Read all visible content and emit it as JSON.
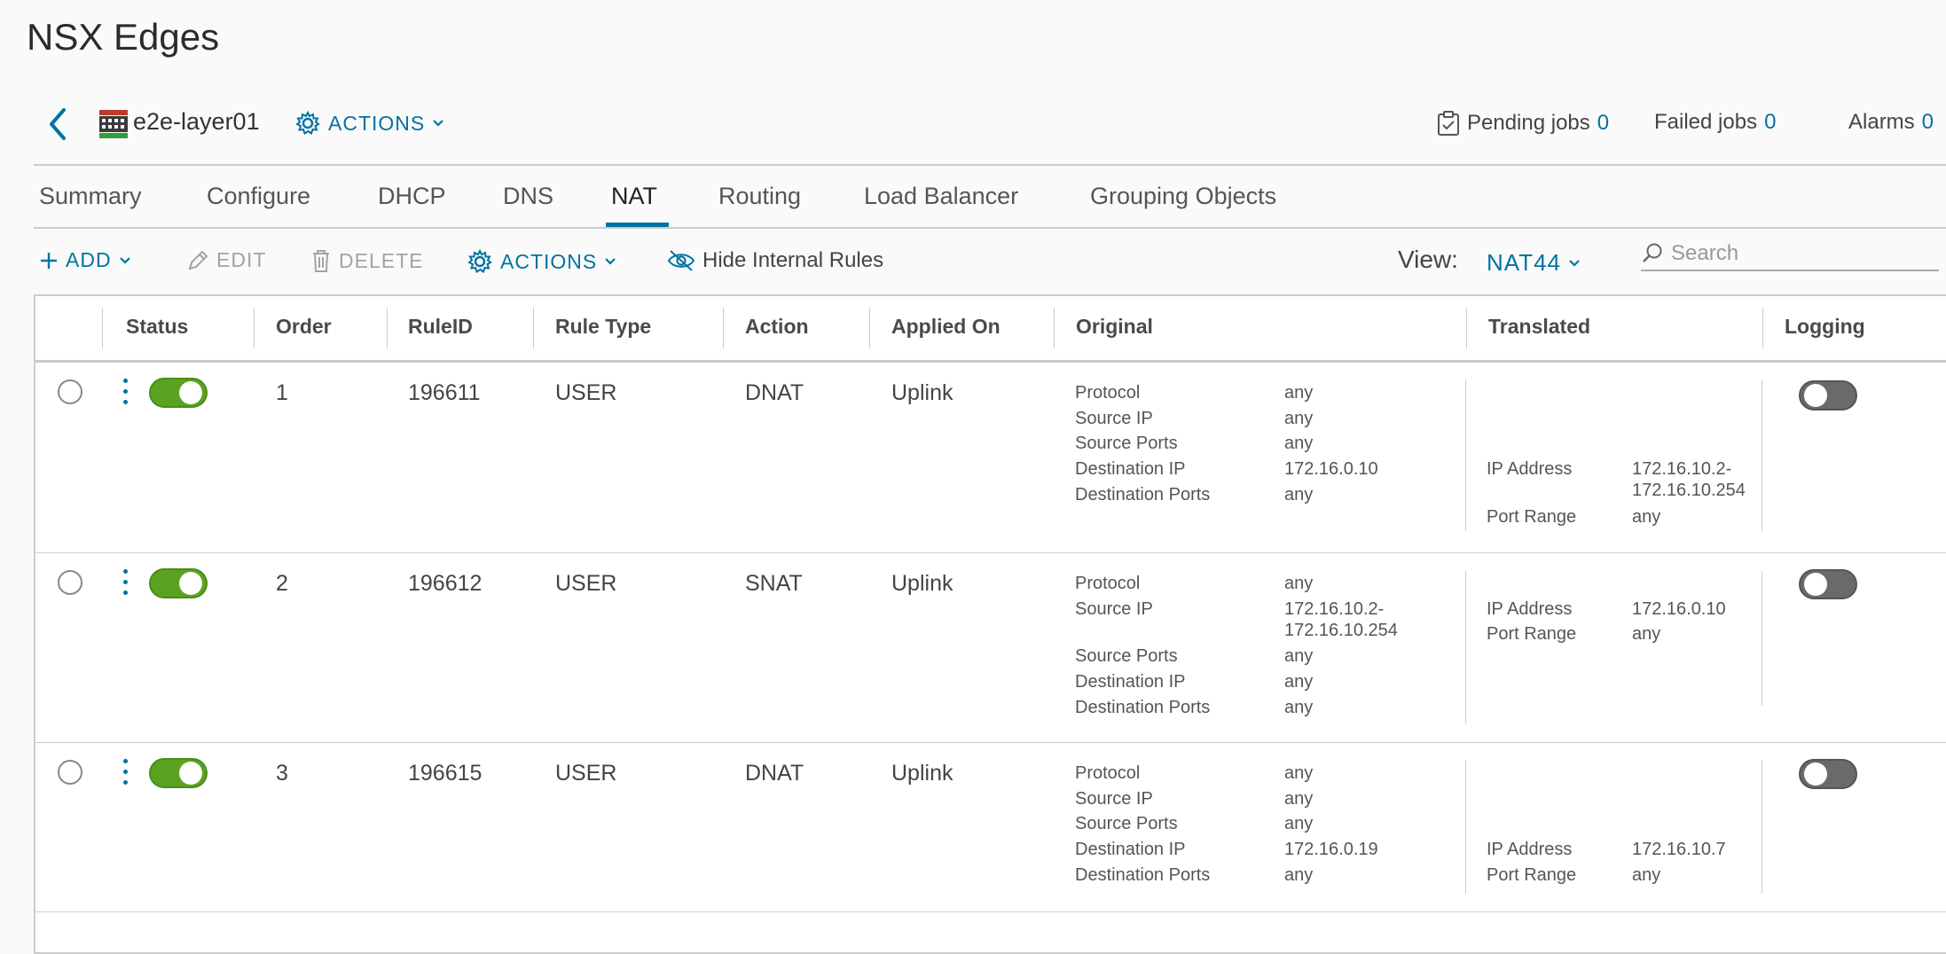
{
  "page_title": "NSX Edges",
  "edge_header": {
    "name": "e2e-layer01",
    "actions_label": "ACTIONS",
    "pending_jobs_label": "Pending jobs",
    "pending_jobs_count": "0",
    "failed_jobs_label": "Failed jobs",
    "failed_jobs_count": "0",
    "alarms_label": "Alarms",
    "alarms_count": "0"
  },
  "tabs": [
    "Summary",
    "Configure",
    "DHCP",
    "DNS",
    "NAT",
    "Routing",
    "Load Balancer",
    "Grouping Objects"
  ],
  "active_tab": "NAT",
  "toolbar": {
    "add_label": "ADD",
    "edit_label": "EDIT",
    "delete_label": "DELETE",
    "actions_label": "ACTIONS",
    "hide_internal_label": "Hide Internal Rules",
    "view_label": "View:",
    "view_value": "NAT44",
    "search_placeholder": "Search"
  },
  "columns": [
    "Status",
    "Order",
    "RuleID",
    "Rule Type",
    "Action",
    "Applied On",
    "Original",
    "Translated",
    "Logging"
  ],
  "rules": [
    {
      "status_enabled": true,
      "order": "1",
      "rule_id": "196611",
      "rule_type": "USER",
      "action": "DNAT",
      "applied_on": "Uplink",
      "original": [
        {
          "label": "Protocol",
          "value": "any"
        },
        {
          "label": "Source IP",
          "value": "any"
        },
        {
          "label": "Source Ports",
          "value": "any"
        },
        {
          "label": "Destination IP",
          "value": "172.16.0.10"
        },
        {
          "label": "Destination Ports",
          "value": "any"
        }
      ],
      "translated": [
        {
          "label": "IP Address",
          "value": "172.16.10.2-",
          "value2": "172.16.10.254"
        },
        {
          "label": "Port Range",
          "value": "any"
        }
      ],
      "logging_enabled": false
    },
    {
      "status_enabled": true,
      "order": "2",
      "rule_id": "196612",
      "rule_type": "USER",
      "action": "SNAT",
      "applied_on": "Uplink",
      "original": [
        {
          "label": "Protocol",
          "value": "any"
        },
        {
          "label": "Source IP",
          "value": "172.16.10.2-",
          "value2": "172.16.10.254"
        },
        {
          "label": "Source Ports",
          "value": "any"
        },
        {
          "label": "Destination IP",
          "value": "any"
        },
        {
          "label": "Destination Ports",
          "value": "any"
        }
      ],
      "translated": [
        {
          "label": "IP Address",
          "value": "172.16.0.10"
        },
        {
          "label": "Port Range",
          "value": "any"
        }
      ],
      "logging_enabled": false
    },
    {
      "status_enabled": true,
      "order": "3",
      "rule_id": "196615",
      "rule_type": "USER",
      "action": "DNAT",
      "applied_on": "Uplink",
      "original": [
        {
          "label": "Protocol",
          "value": "any"
        },
        {
          "label": "Source IP",
          "value": "any"
        },
        {
          "label": "Source Ports",
          "value": "any"
        },
        {
          "label": "Destination IP",
          "value": "172.16.0.19"
        },
        {
          "label": "Destination Ports",
          "value": "any"
        }
      ],
      "translated": [
        {
          "label": "IP Address",
          "value": "172.16.10.7"
        },
        {
          "label": "Port Range",
          "value": "any"
        }
      ],
      "logging_enabled": false
    }
  ]
}
